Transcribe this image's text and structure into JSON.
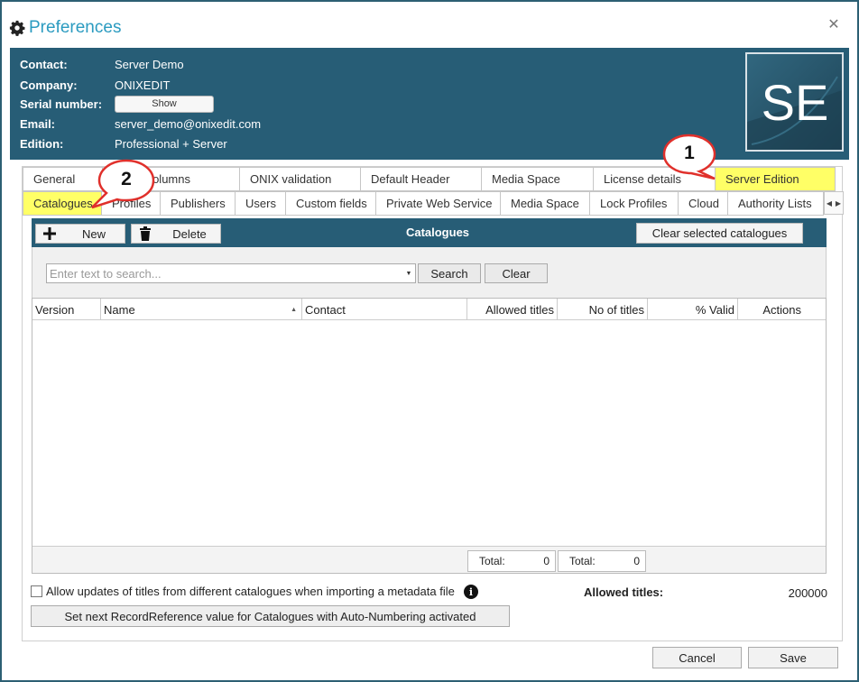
{
  "window": {
    "title": "Preferences"
  },
  "contact": {
    "rows": [
      {
        "label": "Contact:",
        "value": "Server Demo"
      },
      {
        "label": "Company:",
        "value": "ONIXEDIT"
      },
      {
        "label": "Serial number:",
        "button": "Show"
      },
      {
        "label": "Email:",
        "value": "server_demo@onixedit.com"
      },
      {
        "label": "Edition:",
        "value": "Professional + Server"
      }
    ],
    "logo_text": "SE"
  },
  "tabs_top": [
    "General",
    "Table Columns",
    "ONIX validation",
    "Default Header",
    "Media Space",
    "License details",
    "Server Edition"
  ],
  "tabs_sub": [
    "Catalogues",
    "Profiles",
    "Publishers",
    "Users",
    "Custom fields",
    "Private Web Service",
    "Media Space",
    "Lock Profiles",
    "Cloud",
    "Authority Lists"
  ],
  "toolbar": {
    "new_label": "New",
    "delete_label": "Delete",
    "title": "Catalogues",
    "clear_selected_label": "Clear selected catalogues"
  },
  "search": {
    "placeholder": "Enter text to search...",
    "search_label": "Search",
    "clear_label": "Clear"
  },
  "grid": {
    "columns": [
      "Version",
      "Name",
      "Contact",
      "Allowed titles",
      "No of titles",
      "% Valid",
      "Actions"
    ],
    "footer": [
      {
        "label": "Total:",
        "value": "0"
      },
      {
        "label": "Total:",
        "value": "0"
      }
    ]
  },
  "options": {
    "allow_updates_label": "Allow updates of titles from different catalogues when importing a metadata file",
    "allowed_titles_label": "Allowed titles:",
    "allowed_titles_value": "200000",
    "recref_button_label": "Set next RecordReference value for Catalogues with Auto-Numbering activated"
  },
  "footer": {
    "cancel_label": "Cancel",
    "save_label": "Save"
  },
  "callouts": [
    "1",
    "2"
  ],
  "colors": {
    "header_bg": "#275d76",
    "title_accent": "#2b9bc0",
    "highlight": "#ffff66",
    "callout_fill": "#ffffff",
    "callout_stroke": "#e0302b"
  }
}
